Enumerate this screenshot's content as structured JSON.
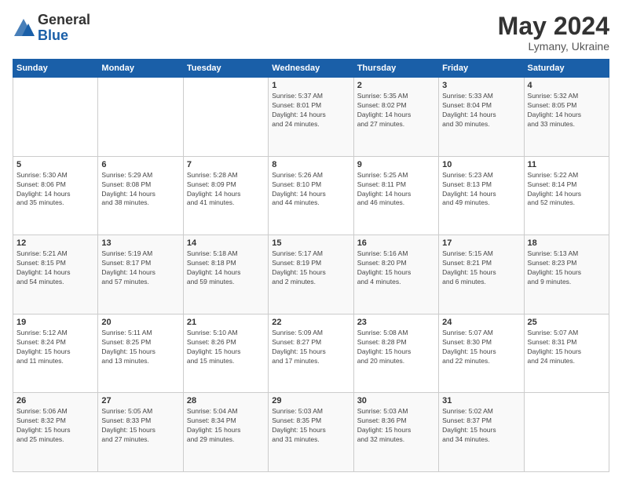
{
  "header": {
    "logo_general": "General",
    "logo_blue": "Blue",
    "month_title": "May 2024",
    "location": "Lymany, Ukraine"
  },
  "days_of_week": [
    "Sunday",
    "Monday",
    "Tuesday",
    "Wednesday",
    "Thursday",
    "Friday",
    "Saturday"
  ],
  "weeks": [
    {
      "days": [
        {
          "number": "",
          "info": ""
        },
        {
          "number": "",
          "info": ""
        },
        {
          "number": "",
          "info": ""
        },
        {
          "number": "1",
          "info": "Sunrise: 5:37 AM\nSunset: 8:01 PM\nDaylight: 14 hours\nand 24 minutes."
        },
        {
          "number": "2",
          "info": "Sunrise: 5:35 AM\nSunset: 8:02 PM\nDaylight: 14 hours\nand 27 minutes."
        },
        {
          "number": "3",
          "info": "Sunrise: 5:33 AM\nSunset: 8:04 PM\nDaylight: 14 hours\nand 30 minutes."
        },
        {
          "number": "4",
          "info": "Sunrise: 5:32 AM\nSunset: 8:05 PM\nDaylight: 14 hours\nand 33 minutes."
        }
      ]
    },
    {
      "days": [
        {
          "number": "5",
          "info": "Sunrise: 5:30 AM\nSunset: 8:06 PM\nDaylight: 14 hours\nand 35 minutes."
        },
        {
          "number": "6",
          "info": "Sunrise: 5:29 AM\nSunset: 8:08 PM\nDaylight: 14 hours\nand 38 minutes."
        },
        {
          "number": "7",
          "info": "Sunrise: 5:28 AM\nSunset: 8:09 PM\nDaylight: 14 hours\nand 41 minutes."
        },
        {
          "number": "8",
          "info": "Sunrise: 5:26 AM\nSunset: 8:10 PM\nDaylight: 14 hours\nand 44 minutes."
        },
        {
          "number": "9",
          "info": "Sunrise: 5:25 AM\nSunset: 8:11 PM\nDaylight: 14 hours\nand 46 minutes."
        },
        {
          "number": "10",
          "info": "Sunrise: 5:23 AM\nSunset: 8:13 PM\nDaylight: 14 hours\nand 49 minutes."
        },
        {
          "number": "11",
          "info": "Sunrise: 5:22 AM\nSunset: 8:14 PM\nDaylight: 14 hours\nand 52 minutes."
        }
      ]
    },
    {
      "days": [
        {
          "number": "12",
          "info": "Sunrise: 5:21 AM\nSunset: 8:15 PM\nDaylight: 14 hours\nand 54 minutes."
        },
        {
          "number": "13",
          "info": "Sunrise: 5:19 AM\nSunset: 8:17 PM\nDaylight: 14 hours\nand 57 minutes."
        },
        {
          "number": "14",
          "info": "Sunrise: 5:18 AM\nSunset: 8:18 PM\nDaylight: 14 hours\nand 59 minutes."
        },
        {
          "number": "15",
          "info": "Sunrise: 5:17 AM\nSunset: 8:19 PM\nDaylight: 15 hours\nand 2 minutes."
        },
        {
          "number": "16",
          "info": "Sunrise: 5:16 AM\nSunset: 8:20 PM\nDaylight: 15 hours\nand 4 minutes."
        },
        {
          "number": "17",
          "info": "Sunrise: 5:15 AM\nSunset: 8:21 PM\nDaylight: 15 hours\nand 6 minutes."
        },
        {
          "number": "18",
          "info": "Sunrise: 5:13 AM\nSunset: 8:23 PM\nDaylight: 15 hours\nand 9 minutes."
        }
      ]
    },
    {
      "days": [
        {
          "number": "19",
          "info": "Sunrise: 5:12 AM\nSunset: 8:24 PM\nDaylight: 15 hours\nand 11 minutes."
        },
        {
          "number": "20",
          "info": "Sunrise: 5:11 AM\nSunset: 8:25 PM\nDaylight: 15 hours\nand 13 minutes."
        },
        {
          "number": "21",
          "info": "Sunrise: 5:10 AM\nSunset: 8:26 PM\nDaylight: 15 hours\nand 15 minutes."
        },
        {
          "number": "22",
          "info": "Sunrise: 5:09 AM\nSunset: 8:27 PM\nDaylight: 15 hours\nand 17 minutes."
        },
        {
          "number": "23",
          "info": "Sunrise: 5:08 AM\nSunset: 8:28 PM\nDaylight: 15 hours\nand 20 minutes."
        },
        {
          "number": "24",
          "info": "Sunrise: 5:07 AM\nSunset: 8:30 PM\nDaylight: 15 hours\nand 22 minutes."
        },
        {
          "number": "25",
          "info": "Sunrise: 5:07 AM\nSunset: 8:31 PM\nDaylight: 15 hours\nand 24 minutes."
        }
      ]
    },
    {
      "days": [
        {
          "number": "26",
          "info": "Sunrise: 5:06 AM\nSunset: 8:32 PM\nDaylight: 15 hours\nand 25 minutes."
        },
        {
          "number": "27",
          "info": "Sunrise: 5:05 AM\nSunset: 8:33 PM\nDaylight: 15 hours\nand 27 minutes."
        },
        {
          "number": "28",
          "info": "Sunrise: 5:04 AM\nSunset: 8:34 PM\nDaylight: 15 hours\nand 29 minutes."
        },
        {
          "number": "29",
          "info": "Sunrise: 5:03 AM\nSunset: 8:35 PM\nDaylight: 15 hours\nand 31 minutes."
        },
        {
          "number": "30",
          "info": "Sunrise: 5:03 AM\nSunset: 8:36 PM\nDaylight: 15 hours\nand 32 minutes."
        },
        {
          "number": "31",
          "info": "Sunrise: 5:02 AM\nSunset: 8:37 PM\nDaylight: 15 hours\nand 34 minutes."
        },
        {
          "number": "",
          "info": ""
        }
      ]
    }
  ]
}
